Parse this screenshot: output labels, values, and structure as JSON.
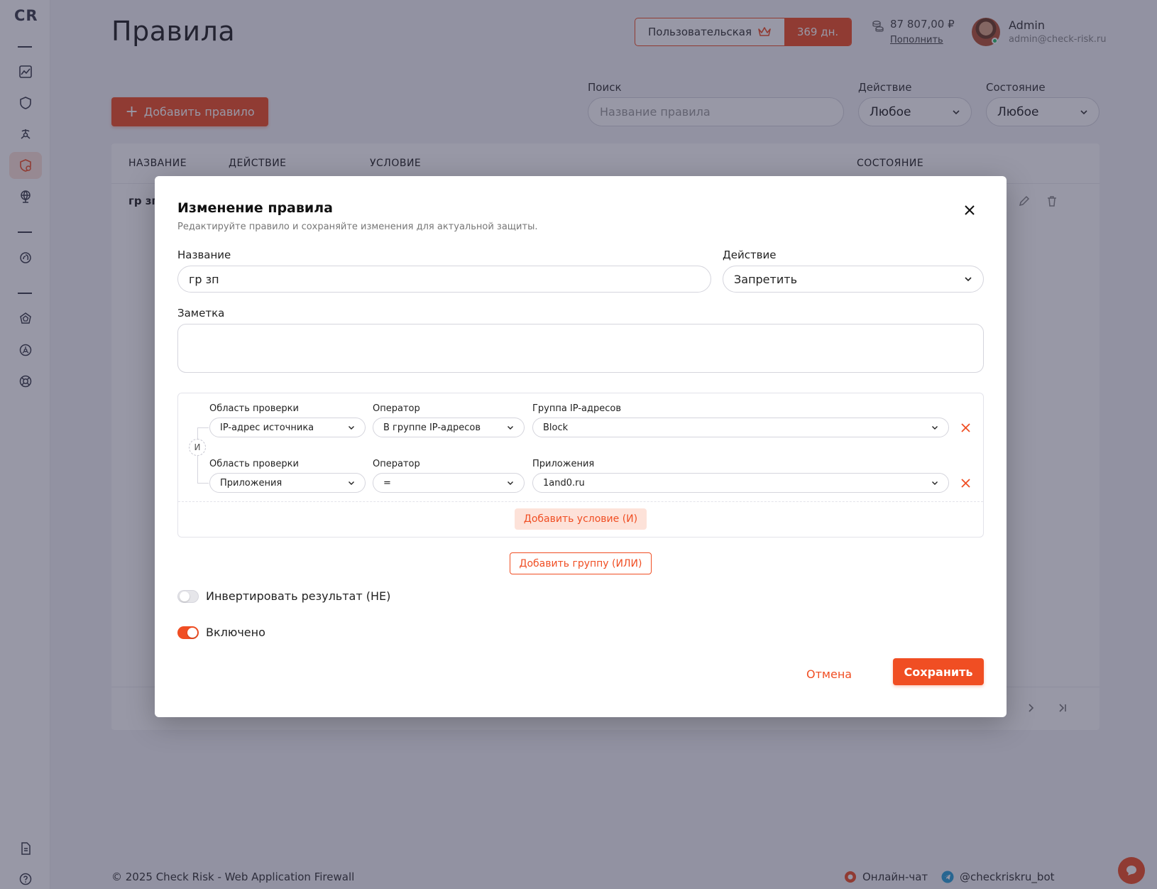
{
  "app": {
    "logo": "CR"
  },
  "header": {
    "title": "Правила",
    "plan_name": "Пользовательская",
    "plan_days": "369 дн.",
    "balance": "87 807,00 ₽",
    "topup": "Пополнить",
    "user_name": "Admin",
    "user_email": "admin@check-risk.ru"
  },
  "toolbar": {
    "add_rule": "Добавить правило",
    "search_label": "Поиск",
    "search_placeholder": "Название правила",
    "action_label": "Действие",
    "action_value": "Любое",
    "state_label": "Состояние",
    "state_value": "Любое"
  },
  "table": {
    "columns": [
      "НАЗВАНИЕ",
      "ДЕЙСТВИЕ",
      "УСЛОВИЕ",
      "СОСТОЯНИЕ"
    ],
    "rows": [
      {
        "name": "гр зп"
      }
    ]
  },
  "modal": {
    "title": "Изменение правила",
    "subtitle": "Редактируйте правило и сохраняйте изменения для актуальной защиты.",
    "name_label": "Название",
    "name_value": "гр зп",
    "action_label": "Действие",
    "action_value": "Запретить",
    "note_label": "Заметка",
    "note_value": "",
    "and_badge": "И",
    "conditions": [
      {
        "scope_label": "Область проверки",
        "scope_value": "IP-адрес источника",
        "operator_label": "Оператор",
        "operator_value": "В группе IP-адресов",
        "value_label": "Группа IP-адресов",
        "value_value": "Block"
      },
      {
        "scope_label": "Область проверки",
        "scope_value": "Приложения",
        "operator_label": "Оператор",
        "operator_value": "=",
        "value_label": "Приложения",
        "value_value": "1and0.ru"
      }
    ],
    "add_condition": "Добавить условие (И)",
    "add_group": "Добавить группу (ИЛИ)",
    "invert_label": "Инвертировать результат (НЕ)",
    "invert_on": false,
    "enabled_label": "Включено",
    "enabled_on": true,
    "cancel": "Отмена",
    "save": "Сохранить"
  },
  "footer": {
    "copyright": "© 2025 Check Risk - Web Application Firewall",
    "chat": "Онлайн-чат",
    "bot": "@checkriskru_bot"
  },
  "colors": {
    "accent": "#f04e23",
    "accent_soft": "#fde2d9",
    "text": "#1f1f1f",
    "overlay": "rgba(40,40,70,0.48)"
  }
}
